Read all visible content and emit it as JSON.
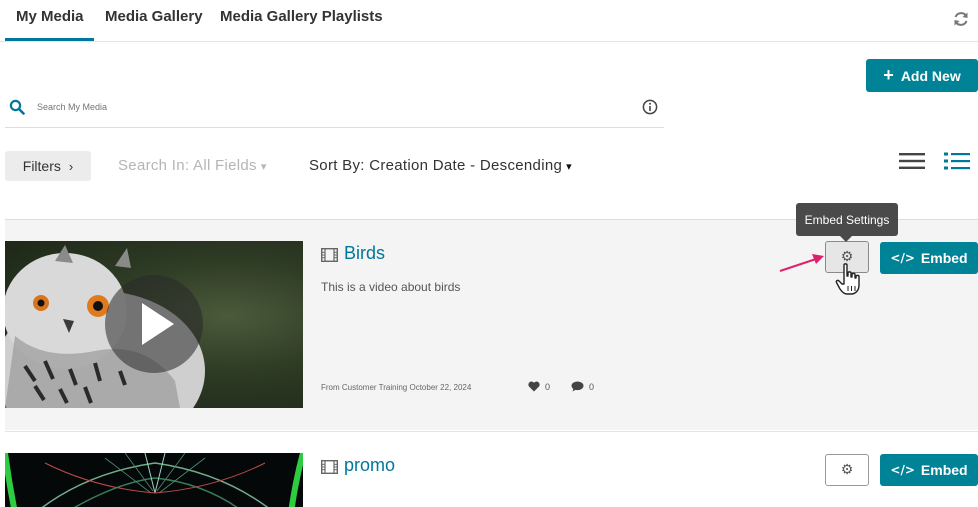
{
  "tabs": [
    {
      "label": "My Media",
      "active": true
    },
    {
      "label": "Media Gallery",
      "active": false
    },
    {
      "label": "Media Gallery Playlists",
      "active": false
    }
  ],
  "toolbar": {
    "add_new_label": "Add New"
  },
  "search": {
    "placeholder": "Search My Media",
    "value": ""
  },
  "filters": {
    "filters_label": "Filters",
    "search_in_label": "Search In: All Fields",
    "sort_by_label": "Sort By: Creation Date - Descending"
  },
  "tooltip": {
    "text": "Embed Settings"
  },
  "entries": [
    {
      "title": "Birds",
      "description": "This is a video about birds",
      "meta": "From Customer Training October 22, 2024",
      "likes": "0",
      "comments": "0",
      "embed_label": "Embed"
    },
    {
      "title": "promo",
      "embed_label": "Embed"
    }
  ],
  "colors": {
    "accent": "#008297",
    "title_link": "#00779b",
    "annotation_arrow": "#e0206f"
  },
  "icons": [
    "refresh-icon",
    "plus-icon",
    "search-icon",
    "info-icon",
    "chevron-right-icon",
    "chevron-down-icon",
    "list-compact-icon",
    "list-detail-icon",
    "play-icon",
    "video-icon",
    "heart-icon",
    "comment-icon",
    "gear-icon",
    "code-icon",
    "hand-cursor-icon"
  ]
}
